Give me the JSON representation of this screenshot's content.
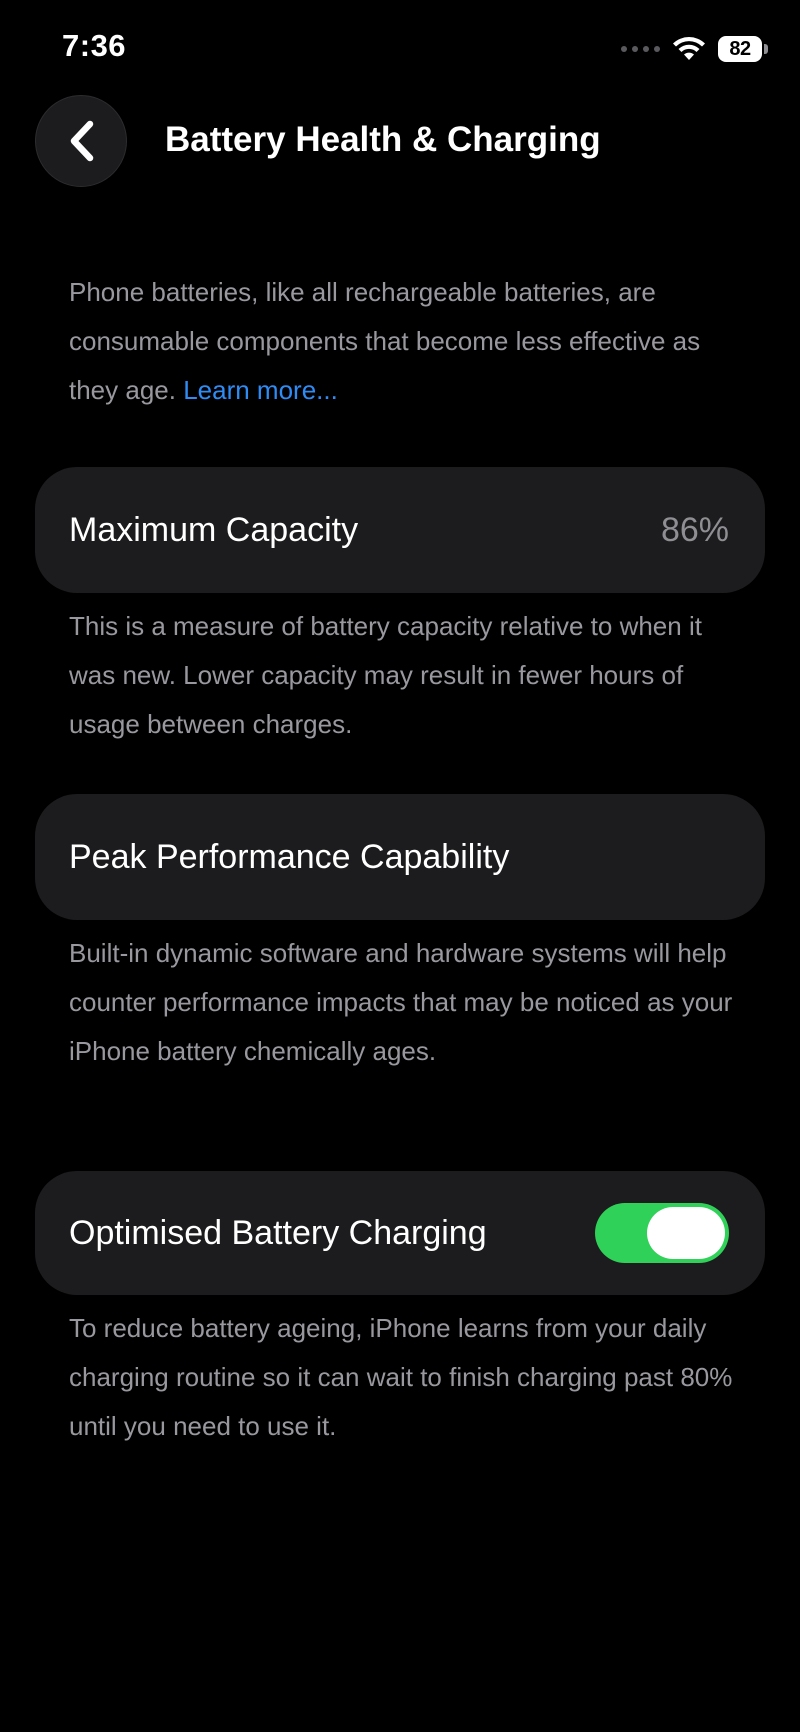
{
  "status_bar": {
    "time": "7:36",
    "battery_level": "82",
    "icons": [
      "cellular-signal-icon",
      "wifi-icon",
      "battery-icon"
    ]
  },
  "header": {
    "back_icon": "chevron-left-icon",
    "title": "Battery Health & Charging"
  },
  "intro": {
    "text": "Phone batteries, like all rechargeable batteries, are consumable components that become less effective as they age. ",
    "link": "Learn more..."
  },
  "maximum_capacity": {
    "label": "Maximum Capacity",
    "value": "86%",
    "description": "This is a measure of battery capacity relative to when it was new. Lower capacity may result in fewer hours of usage between charges."
  },
  "peak_performance": {
    "label": "Peak Performance Capability",
    "description": "Built-in dynamic software and hardware systems will help counter performance impacts that may be noticed as your iPhone battery chemically ages."
  },
  "optimised_charging": {
    "label": "Optimised Battery Charging",
    "toggle_on": true,
    "description": "To reduce battery ageing, iPhone learns from your daily charging routine so it can wait to finish charging past 80% until you need to use it."
  },
  "colors": {
    "background": "#000000",
    "card": "#1c1c1e",
    "secondary_text": "#98989e",
    "link": "#2f8cf5",
    "toggle_on": "#30d158"
  }
}
